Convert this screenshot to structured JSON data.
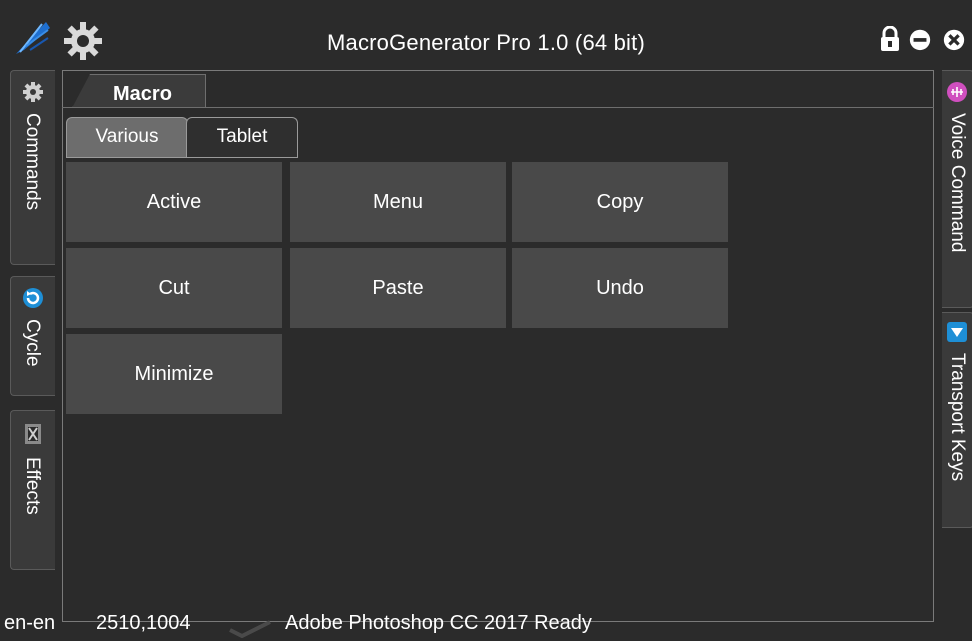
{
  "window": {
    "title": "MacroGenerator Pro 1.0 (64 bit)",
    "logo_icon": "feather-logo-icon",
    "settings_icon": "gear-icon",
    "controls": [
      "lock-icon",
      "minimize-icon",
      "close-icon"
    ]
  },
  "left_tabs": [
    {
      "label": "Commands",
      "icon": "gear-icon"
    },
    {
      "label": "Cycle",
      "icon": "cycle-icon"
    },
    {
      "label": "Effects",
      "icon": "film-icon"
    }
  ],
  "right_tabs": [
    {
      "label": "Voice Command",
      "icon": "voice-icon"
    },
    {
      "label": "Transport Keys",
      "icon": "triangle-down-icon"
    }
  ],
  "main": {
    "tab": "Macro",
    "subtabs": [
      "Various",
      "Tablet"
    ],
    "active_subtab": "Various",
    "buttons": [
      "Active",
      "Menu",
      "Copy",
      "Cut",
      "Paste",
      "Undo",
      "Minimize"
    ]
  },
  "status": {
    "locale": "en-en",
    "coordinates": "2510,1004",
    "check_icon": "checkmark-icon",
    "message": "Adobe Photoshop CC 2017 Ready"
  },
  "colors": {
    "background": "#2b2b2b",
    "button": "#494949",
    "active_subtab": "#6d6d6d",
    "accent_blue": "#1e8fd6",
    "voice_pink": "#d04fbf"
  }
}
